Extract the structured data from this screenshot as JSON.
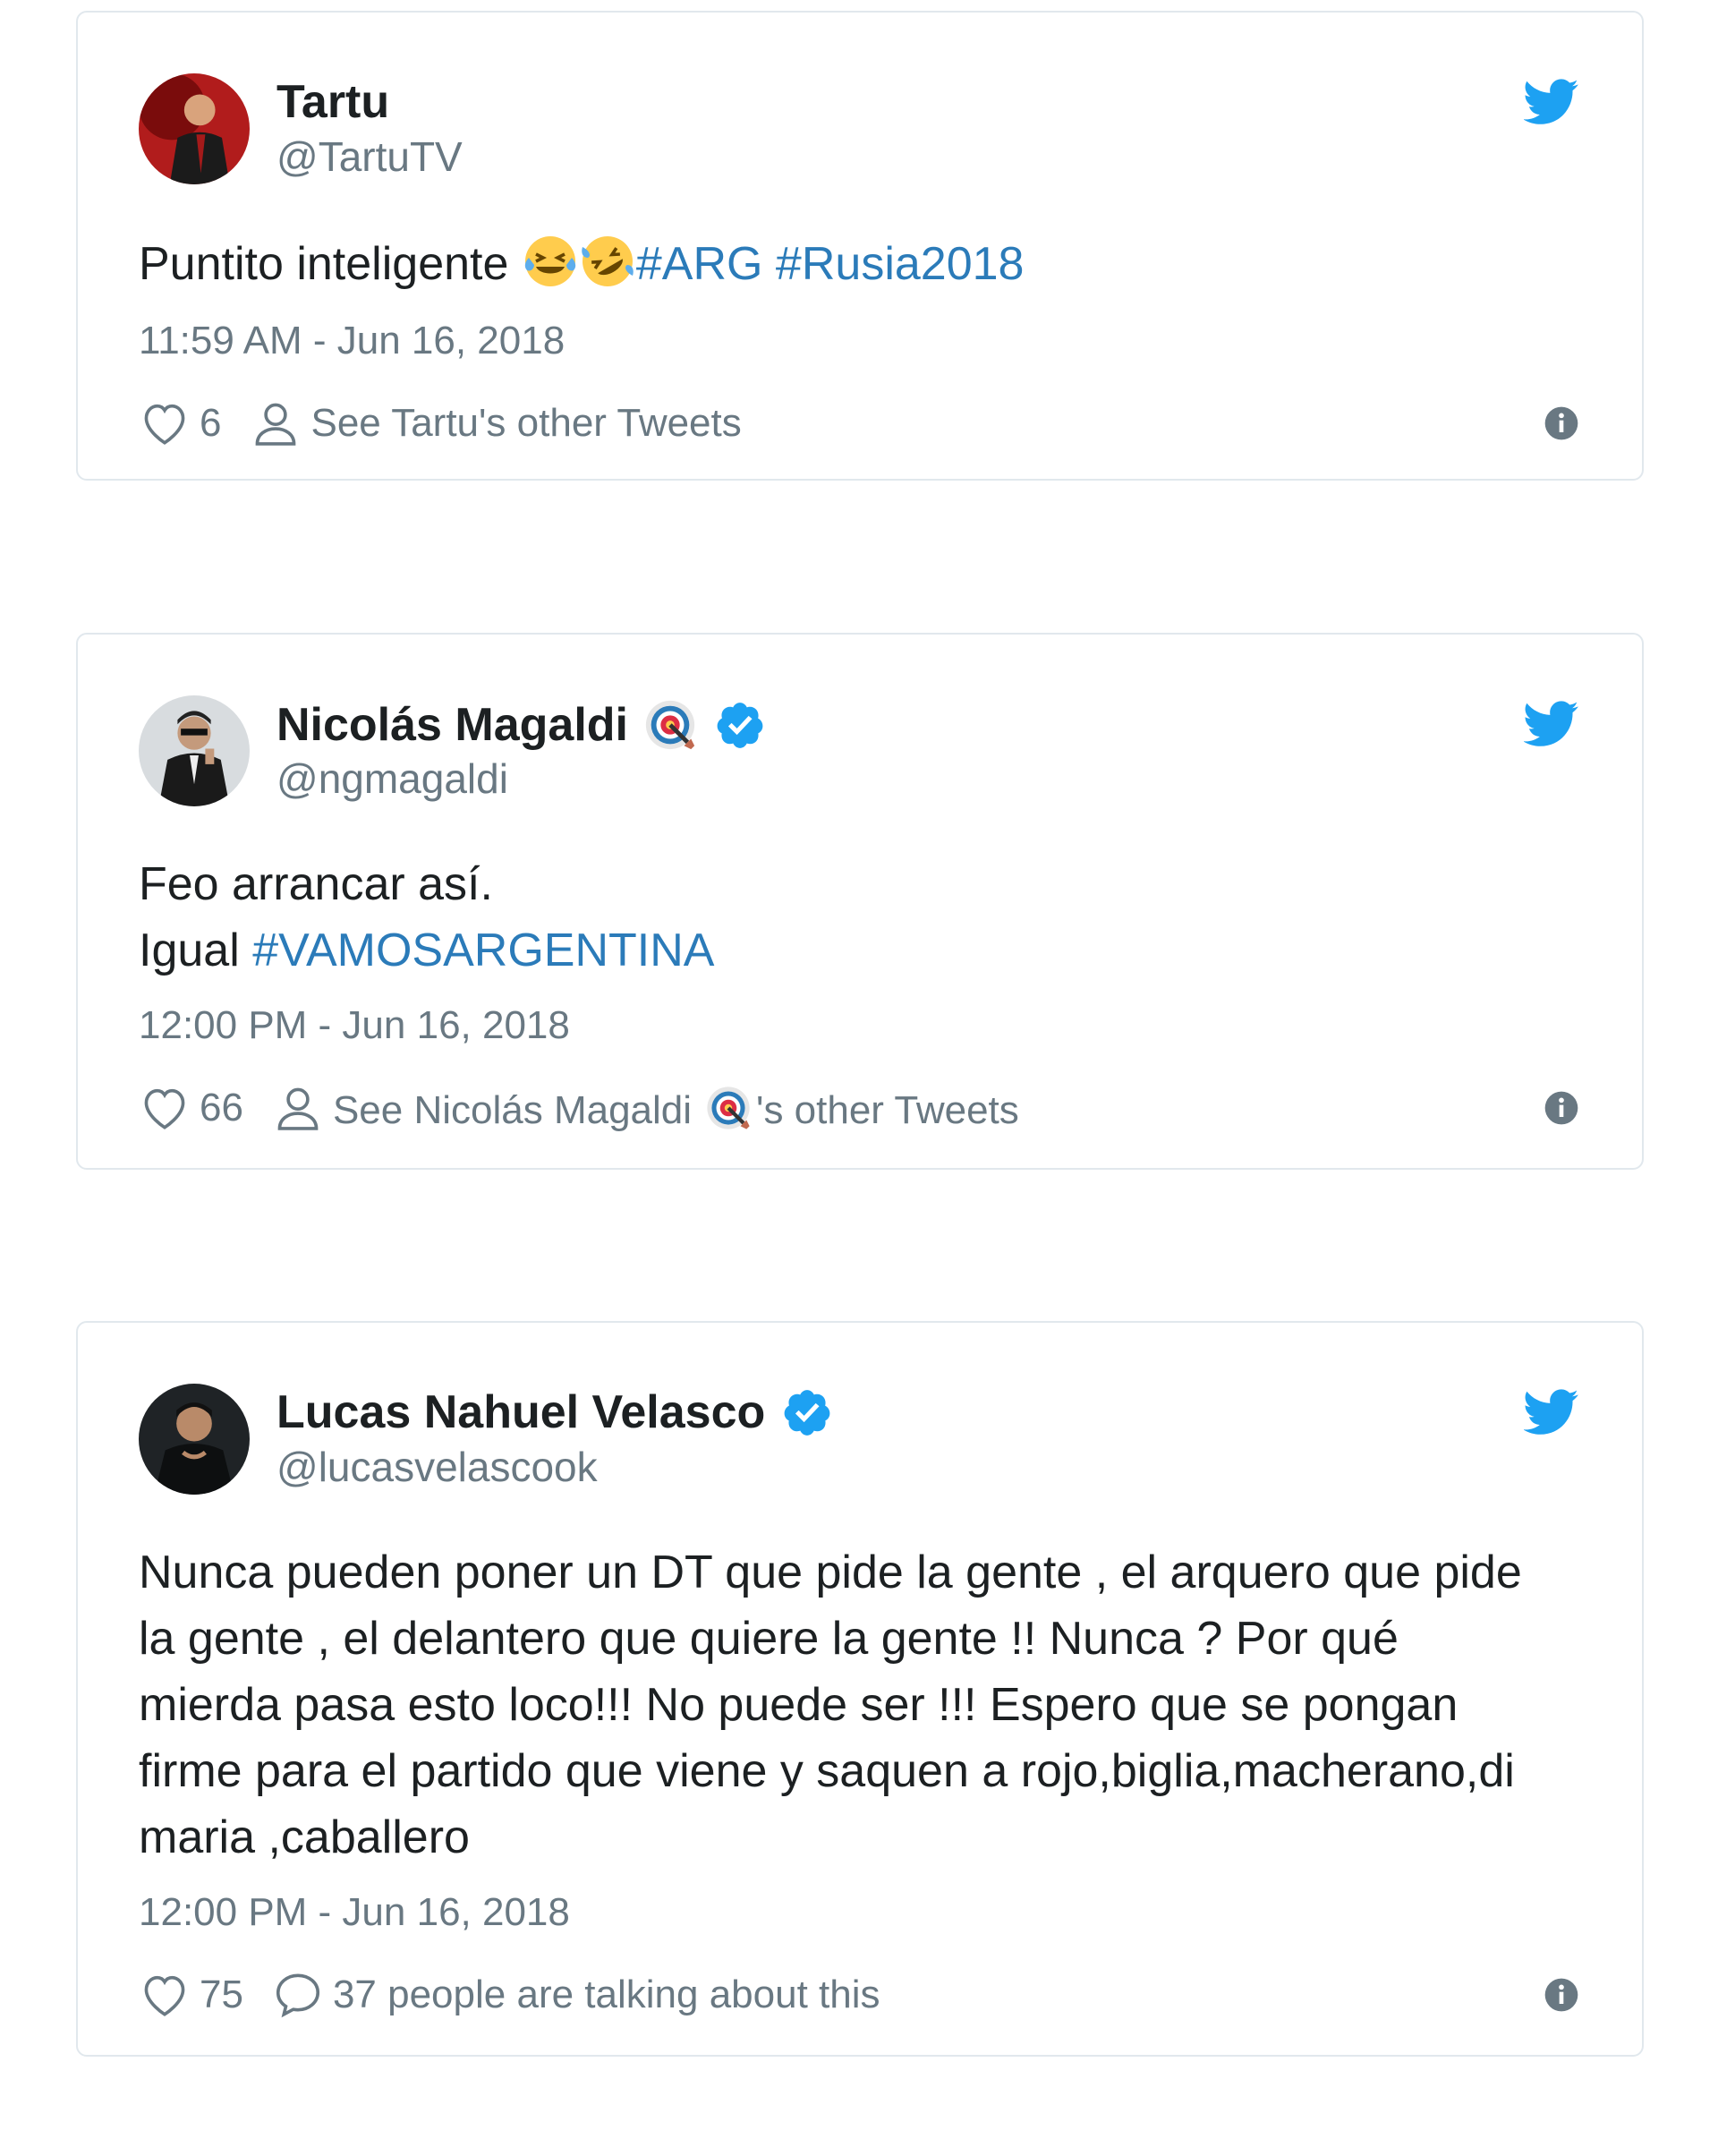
{
  "colors": {
    "link": "#2b7bb9",
    "muted": "#697882",
    "twitter_blue": "#1da1f2",
    "border": "#e1e8ed"
  },
  "tweets": [
    {
      "name": "Tartu",
      "handle": "@TartuTV",
      "text_plain": "Puntito inteligente ",
      "emojis": [
        "joy-emoji",
        "rofl-emoji"
      ],
      "hashtags": [
        "#ARG",
        "#Rusia2018"
      ],
      "timestamp": "11:59 AM - Jun 16, 2018",
      "likes": "6",
      "secondary_action": "See Tartu's other Tweets"
    },
    {
      "name": "Nicolás Magaldi",
      "handle": "@ngmagaldi",
      "verified": true,
      "name_emoji": "target-emoji",
      "line1": "Feo arrancar así.",
      "line2_plain": "Igual ",
      "line2_hashtag": "#VAMOSARGENTINA",
      "timestamp": "12:00 PM - Jun 16, 2018",
      "likes": "66",
      "secondary_action_before": "See Nicolás Magaldi",
      "secondary_action_after": "'s other Tweets"
    },
    {
      "name": "Lucas Nahuel Velasco",
      "handle": "@lucasvelascook",
      "verified": true,
      "lines": [
        "Nunca pueden poner un DT que pide la gente , el arquero que pide",
        "la gente , el delantero que quiere la gente !! Nunca ? Por qué",
        "mierda pasa esto loco!!! No puede ser !!! Espero que se pongan",
        "firme para el partido que viene y saquen a rojo,biglia,macherano,di",
        "maria ,caballero"
      ],
      "timestamp": "12:00 PM - Jun 16, 2018",
      "likes": "75",
      "secondary_action": "37 people are talking about this"
    }
  ]
}
